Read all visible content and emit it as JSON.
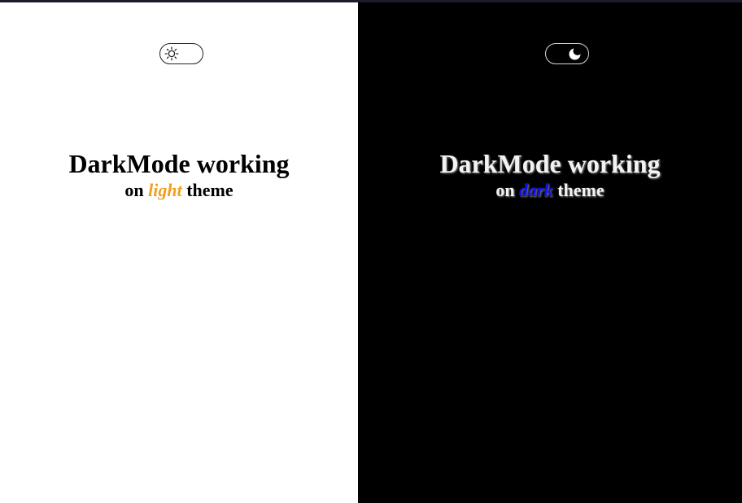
{
  "light_panel": {
    "background": "#ffffff",
    "toggle": {
      "state": "light",
      "icon": "sun-icon"
    },
    "heading": {
      "title": "DarkMode working",
      "sub_prefix": "on",
      "mode_word": "light",
      "sub_suffix": "theme"
    },
    "accent_color": "#f0a020"
  },
  "dark_panel": {
    "background": "#000000",
    "toggle": {
      "state": "dark",
      "icon": "moon-icon"
    },
    "heading": {
      "title": "DarkMode working",
      "sub_prefix": "on",
      "mode_word": "dark",
      "sub_suffix": "theme"
    },
    "accent_color": "#1010ee"
  }
}
